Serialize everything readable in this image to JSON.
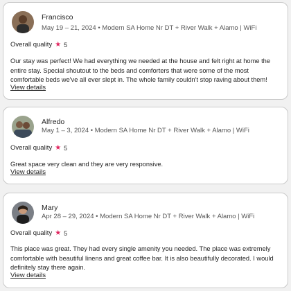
{
  "reviews": [
    {
      "name": "Francisco",
      "meta": "May 19 – 21, 2024 • Modern SA Home Nr DT + River Walk + Alamo | WiFi",
      "quality_label": "Overall quality",
      "rating": "5",
      "text": "Our stay was perfect! We had everything we needed at the house and felt right at home the entire stay. Special shoutout to the beds and comforters that were some of the most comfortable beds we've all ever slept in. The whole family couldn't stop raving about them!",
      "link": "View details"
    },
    {
      "name": "Alfredo",
      "meta": "May 1 – 3, 2024 • Modern SA Home Nr DT + River Walk + Alamo | WiFi",
      "quality_label": "Overall quality",
      "rating": "5",
      "text": "Great space very clean and they are very responsive.",
      "link": "View details"
    },
    {
      "name": "Mary",
      "meta": "Apr 28 – 29, 2024 • Modern SA Home Nr DT + River Walk + Alamo | WiFi",
      "quality_label": "Overall quality",
      "rating": "5",
      "text": "This place was great. They had every single amenity you needed. The place was extremely comfortable with beautiful linens and great coffee bar. It is also beautifully decorated. I would definitely stay there again.",
      "link": "View details"
    }
  ],
  "colors": {
    "star": "#e0245e",
    "border": "#c9c9c9",
    "background": "#f1f1f1"
  },
  "icons": {
    "rating": "star-icon"
  }
}
